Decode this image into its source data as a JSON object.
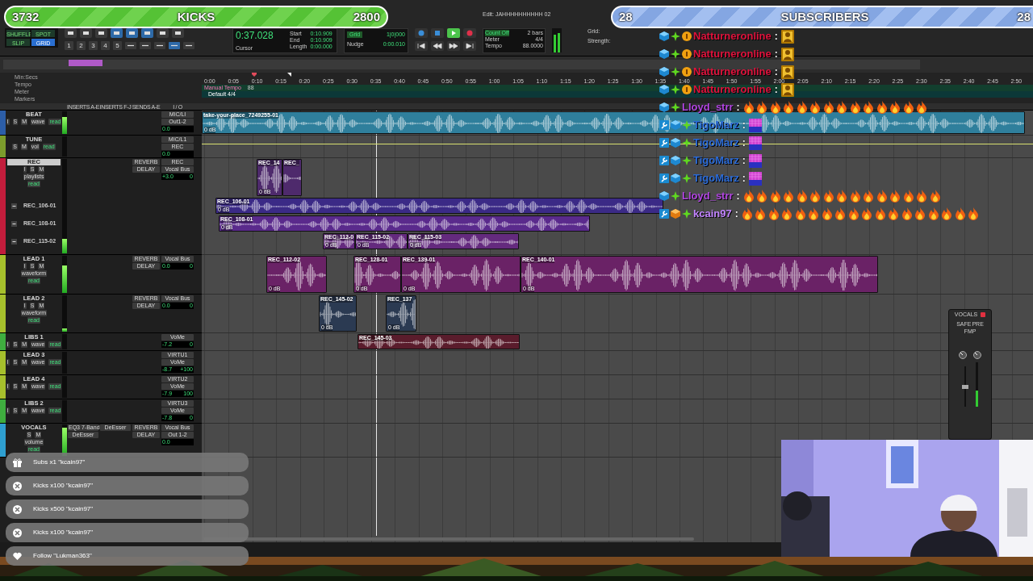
{
  "goals": [
    {
      "kind": "kicks",
      "current": "3732",
      "title": "KICKS",
      "target": "2800"
    },
    {
      "kind": "subscribers",
      "current": "28",
      "title": "SUBSCRIBERS",
      "target": "28"
    }
  ],
  "toolbar": {
    "window_title": "Edit: JAHHHHHHHHHH 02",
    "edit_modes": [
      {
        "label": "SHUFFLE",
        "selected": false
      },
      {
        "label": "SPOT",
        "selected": false
      },
      {
        "label": "SLIP",
        "selected": false
      },
      {
        "label": "GRID",
        "selected": true
      }
    ],
    "zoom_presets": [
      "1",
      "2",
      "3",
      "4",
      "5"
    ],
    "counter": {
      "value": "0:37.028",
      "label": "Cursor",
      "fields": [
        {
          "label": "Start",
          "value": "0:10.909"
        },
        {
          "label": "End",
          "value": "0:10.909"
        },
        {
          "label": "Length",
          "value": "0:00.000"
        }
      ]
    },
    "grid": {
      "label": "Grid",
      "value": "1|0|000"
    },
    "nudge": {
      "label": "Nudge",
      "value": "0:00.010"
    },
    "count_off": "Count Off",
    "bars": "2 bars",
    "meter": {
      "label": "Meter",
      "value": "4/4"
    },
    "tempo": {
      "label": "Tempo",
      "value": "88.0000"
    },
    "quantize": [
      "Grid:",
      "Strength:"
    ]
  },
  "rulers": {
    "labels": [
      "Min:Secs",
      "Tempo",
      "Meter",
      "Markers"
    ],
    "ticks": [
      "0:00",
      "0:05",
      "0:10",
      "0:15",
      "0:20",
      "0:25",
      "0:30",
      "0:35",
      "0:40",
      "0:45",
      "0:50",
      "0:55",
      "1:00",
      "1:05",
      "1:10",
      "1:15",
      "1:20",
      "1:25",
      "1:30",
      "1:35",
      "1:40",
      "1:45",
      "1:50",
      "1:55",
      "2:00",
      "2:05",
      "2:10",
      "2:15",
      "2:20",
      "2:25",
      "2:30",
      "2:35",
      "2:40",
      "2:45",
      "2:50"
    ],
    "tempo": "Manual Tempo",
    "tempo_value": "88",
    "meter": "Default 4/4"
  },
  "columns": [
    "INSERTS A-E",
    "INSERTS F-J",
    "SENDS A-E",
    "I / O"
  ],
  "tracks": [
    {
      "name": "BEAT",
      "color": "#2c5ea8",
      "level": 0.75,
      "controls": [
        "I",
        "S",
        "M"
      ],
      "view": "wave",
      "automation": "read",
      "input": "MIC/LI",
      "output": "Out1-2",
      "vol": "0.0",
      "clips": [
        {
          "name": "take-your-place_7249255-01",
          "gain": "0 dB",
          "color": "#2f7f9c"
        }
      ]
    },
    {
      "name": "TUNE",
      "color": "#7c9c2c",
      "level": 0,
      "controls": [
        "S",
        "M"
      ],
      "view": "vol",
      "automation": "read",
      "input": "MIC/L1",
      "output": "REC",
      "vol": "0.0"
    },
    {
      "name": "REC",
      "color": "#c21d3c",
      "level": 0.15,
      "controls": [
        "I",
        "S",
        "M"
      ],
      "view": "playlists",
      "automation": "read",
      "sends": [
        "REVERB",
        "DELAY"
      ],
      "input": "REC",
      "output": "Vocal Bus",
      "vol": "+3.0",
      "pan": "0",
      "clips": [
        {
          "name": "REC_14",
          "gain": "0 dB",
          "color": "#4e2a6c"
        },
        {
          "name": "REC_",
          "color": "#4e2a6c"
        }
      ],
      "playlists": [
        {
          "name": "REC_106-01",
          "clips": [
            {
              "name": "REC_106-01",
              "gain": "0 dB",
              "color": "#3b2a86"
            }
          ]
        },
        {
          "name": "REC_108-01",
          "clips": [
            {
              "name": "REC_108-01",
              "gain": "0 dB",
              "color": "#5a2a8c"
            }
          ]
        },
        {
          "name": "REC_115-02",
          "clips": [
            {
              "name": "REC_112-0",
              "gain": "0 dB",
              "color": "#642a7e"
            },
            {
              "name": "REC_115-02",
              "gain": "0 dB",
              "color": "#642a7e"
            },
            {
              "name": "REC_115-03",
              "gain": "0 dB",
              "color": "#642a7e"
            }
          ]
        }
      ]
    },
    {
      "name": "LEAD 1",
      "color": "#a6c02c",
      "level": 0.75,
      "controls": [
        "I",
        "S",
        "M"
      ],
      "view": "waveform",
      "automation": "read",
      "sends": [
        "REVERB",
        "DELAY"
      ],
      "output": "Vocal Bus",
      "vol": "0.0",
      "pan": "0",
      "clips": [
        {
          "name": "REC_112-02",
          "gain": "0 dB",
          "color": "#6a2266"
        },
        {
          "name": "REC_128-01",
          "gain": "0 dB",
          "color": "#6a2266"
        },
        {
          "name": "REC_139-01",
          "gain": "0 dB",
          "color": "#6a2266"
        },
        {
          "name": "REC_140-01",
          "gain": "0 dB",
          "color": "#6a2266"
        }
      ]
    },
    {
      "name": "LEAD 2",
      "color": "#a6c02c",
      "level": 0.1,
      "controls": [
        "I",
        "S",
        "M"
      ],
      "view": "waveform",
      "automation": "read",
      "sends": [
        "REVERB",
        "DELAY"
      ],
      "output": "Vocal Bus",
      "vol": "0.0",
      "pan": "0",
      "clips": [
        {
          "name": "REC_145-02",
          "gain": "0 dB",
          "color": "#2b3a52"
        },
        {
          "name": "REC_137",
          "gain": "0 dB",
          "color": "#2b3a52"
        }
      ]
    },
    {
      "name": "LIBS 1",
      "color": "#3fae3f",
      "level": 0,
      "controls": [
        "I",
        "S",
        "M"
      ],
      "view": "wave",
      "automation": "read",
      "output": "VoMe",
      "vol": "-7.2",
      "pan": "0",
      "clips": [
        {
          "name": "REC_145-03",
          "color": "#5a1c2c"
        }
      ]
    },
    {
      "name": "LEAD 3",
      "color": "#a6c02c",
      "level": 0,
      "controls": [
        "I",
        "S",
        "M"
      ],
      "view": "wave",
      "automation": "read",
      "input": "VIRTU1",
      "output": "VoMe",
      "vol": "-8.7",
      "pan": "+100"
    },
    {
      "name": "LEAD 4",
      "color": "#a6c02c",
      "level": 0,
      "controls": [
        "I",
        "S",
        "M"
      ],
      "view": "wave",
      "automation": "read",
      "input": "VIRTU2",
      "output": "VoMe",
      "vol": "-7.9",
      "pan": "100"
    },
    {
      "name": "LIBS 2",
      "color": "#3fae3f",
      "level": 0,
      "controls": [
        "I",
        "S",
        "M"
      ],
      "view": "wave",
      "automation": "read",
      "input": "VIRTU3",
      "output": "VoMe",
      "vol": "-7.8",
      "pan": "0"
    },
    {
      "name": "VOCALS",
      "color": "#2e9fd0",
      "level": 0.9,
      "controls": [
        "S",
        "M"
      ],
      "view": "volume",
      "automation": "read",
      "inserts": [
        "EQ3 7-Band",
        "DeEsser"
      ],
      "inserts_fj": [
        "DeEsser"
      ],
      "sends": [
        "REVERB",
        "DELAY"
      ],
      "input": "Vocal Bus",
      "output": "Out 1-2",
      "vol": "0.0"
    }
  ],
  "chat": [
    {
      "user": "Natturneronline",
      "color": "#e0123c",
      "badges": [
        {
          "kind": "cube"
        },
        {
          "kind": "sparkle"
        },
        {
          "kind": "coin"
        }
      ],
      "sep": ":",
      "emotes": [
        {
          "kind": "figure"
        }
      ]
    },
    {
      "user": "Natturneronline",
      "color": "#e0123c",
      "badges": [
        {
          "kind": "cube"
        },
        {
          "kind": "sparkle"
        },
        {
          "kind": "coin"
        }
      ],
      "sep": ":",
      "emotes": [
        {
          "kind": "figure"
        }
      ]
    },
    {
      "user": "Natturneronline",
      "color": "#e0123c",
      "badges": [
        {
          "kind": "cube"
        },
        {
          "kind": "sparkle"
        },
        {
          "kind": "coin"
        }
      ],
      "sep": ":",
      "emotes": [
        {
          "kind": "figure"
        }
      ]
    },
    {
      "user": "Natturneronline",
      "color": "#e0123c",
      "badges": [
        {
          "kind": "cube"
        },
        {
          "kind": "sparkle"
        },
        {
          "kind": "coin"
        }
      ],
      "sep": ":",
      "emotes": [
        {
          "kind": "figure"
        }
      ]
    },
    {
      "user": "Lloyd_strr",
      "color": "#b044e0",
      "badges": [
        {
          "kind": "cube"
        },
        {
          "kind": "sparkle"
        }
      ],
      "sep": ":",
      "emotes": [
        {
          "kind": "fire"
        },
        {
          "kind": "fire"
        },
        {
          "kind": "fire"
        },
        {
          "kind": "fire"
        },
        {
          "kind": "fire"
        },
        {
          "kind": "fire"
        },
        {
          "kind": "fire"
        },
        {
          "kind": "fire"
        },
        {
          "kind": "fire"
        },
        {
          "kind": "fire"
        },
        {
          "kind": "fire"
        },
        {
          "kind": "fire"
        },
        {
          "kind": "fire"
        },
        {
          "kind": "fire"
        }
      ]
    },
    {
      "user": "TigoMarz",
      "color": "#2b6bd8",
      "badges": [
        {
          "kind": "wrench"
        },
        {
          "kind": "cube"
        },
        {
          "kind": "sparkle"
        }
      ],
      "sep": ":",
      "emotes": [
        {
          "kind": "grid"
        }
      ]
    },
    {
      "user": "TigoMarz",
      "color": "#2b6bd8",
      "badges": [
        {
          "kind": "wrench"
        },
        {
          "kind": "cube"
        },
        {
          "kind": "sparkle"
        }
      ],
      "sep": ":",
      "emotes": [
        {
          "kind": "grid"
        }
      ]
    },
    {
      "user": "TigoMarz",
      "color": "#2b6bd8",
      "badges": [
        {
          "kind": "wrench"
        },
        {
          "kind": "cube"
        },
        {
          "kind": "sparkle"
        }
      ],
      "sep": ":",
      "emotes": [
        {
          "kind": "grid"
        }
      ]
    },
    {
      "user": "TigoMarz",
      "color": "#2b6bd8",
      "badges": [
        {
          "kind": "wrench"
        },
        {
          "kind": "cube"
        },
        {
          "kind": "sparkle"
        }
      ],
      "sep": ":",
      "emotes": [
        {
          "kind": "grid"
        }
      ]
    },
    {
      "user": "Lloyd_strr",
      "color": "#b044e0",
      "badges": [
        {
          "kind": "cube"
        },
        {
          "kind": "sparkle"
        }
      ],
      "sep": ":",
      "emotes": [
        {
          "kind": "fire"
        },
        {
          "kind": "fire"
        },
        {
          "kind": "fire"
        },
        {
          "kind": "fire"
        },
        {
          "kind": "fire"
        },
        {
          "kind": "fire"
        },
        {
          "kind": "fire"
        },
        {
          "kind": "fire"
        },
        {
          "kind": "fire"
        },
        {
          "kind": "fire"
        },
        {
          "kind": "fire"
        },
        {
          "kind": "fire"
        },
        {
          "kind": "fire"
        },
        {
          "kind": "fire"
        },
        {
          "kind": "fire"
        }
      ]
    },
    {
      "user": "kcain97",
      "color": "#c284ff",
      "badges": [
        {
          "kind": "wrench"
        },
        {
          "kind": "cube-orange"
        },
        {
          "kind": "sparkle"
        }
      ],
      "sep": ":",
      "emotes": [
        {
          "kind": "fire"
        },
        {
          "kind": "fire"
        },
        {
          "kind": "fire"
        },
        {
          "kind": "fire"
        },
        {
          "kind": "fire"
        },
        {
          "kind": "fire"
        },
        {
          "kind": "fire"
        },
        {
          "kind": "fire"
        },
        {
          "kind": "fire"
        },
        {
          "kind": "fire"
        },
        {
          "kind": "fire"
        },
        {
          "kind": "fire"
        },
        {
          "kind": "fire"
        },
        {
          "kind": "fire"
        },
        {
          "kind": "fire"
        },
        {
          "kind": "fire"
        },
        {
          "kind": "fire"
        },
        {
          "kind": "fire"
        }
      ]
    }
  ],
  "alerts": [
    {
      "kind": "gift",
      "text": "Subs x1 \"kcain97\""
    },
    {
      "kind": "kick",
      "text": "Kicks x100 \"kcain97\""
    },
    {
      "kind": "kick",
      "text": "Kicks x500 \"kcain97\""
    },
    {
      "kind": "kick",
      "text": "Kicks x100 \"kcain97\""
    },
    {
      "kind": "heart",
      "text": "Follow \"Lukman363\""
    }
  ],
  "mini_window": {
    "title": "VOCALS",
    "labels": [
      "SAFE",
      "PRE",
      "FMP"
    ]
  }
}
